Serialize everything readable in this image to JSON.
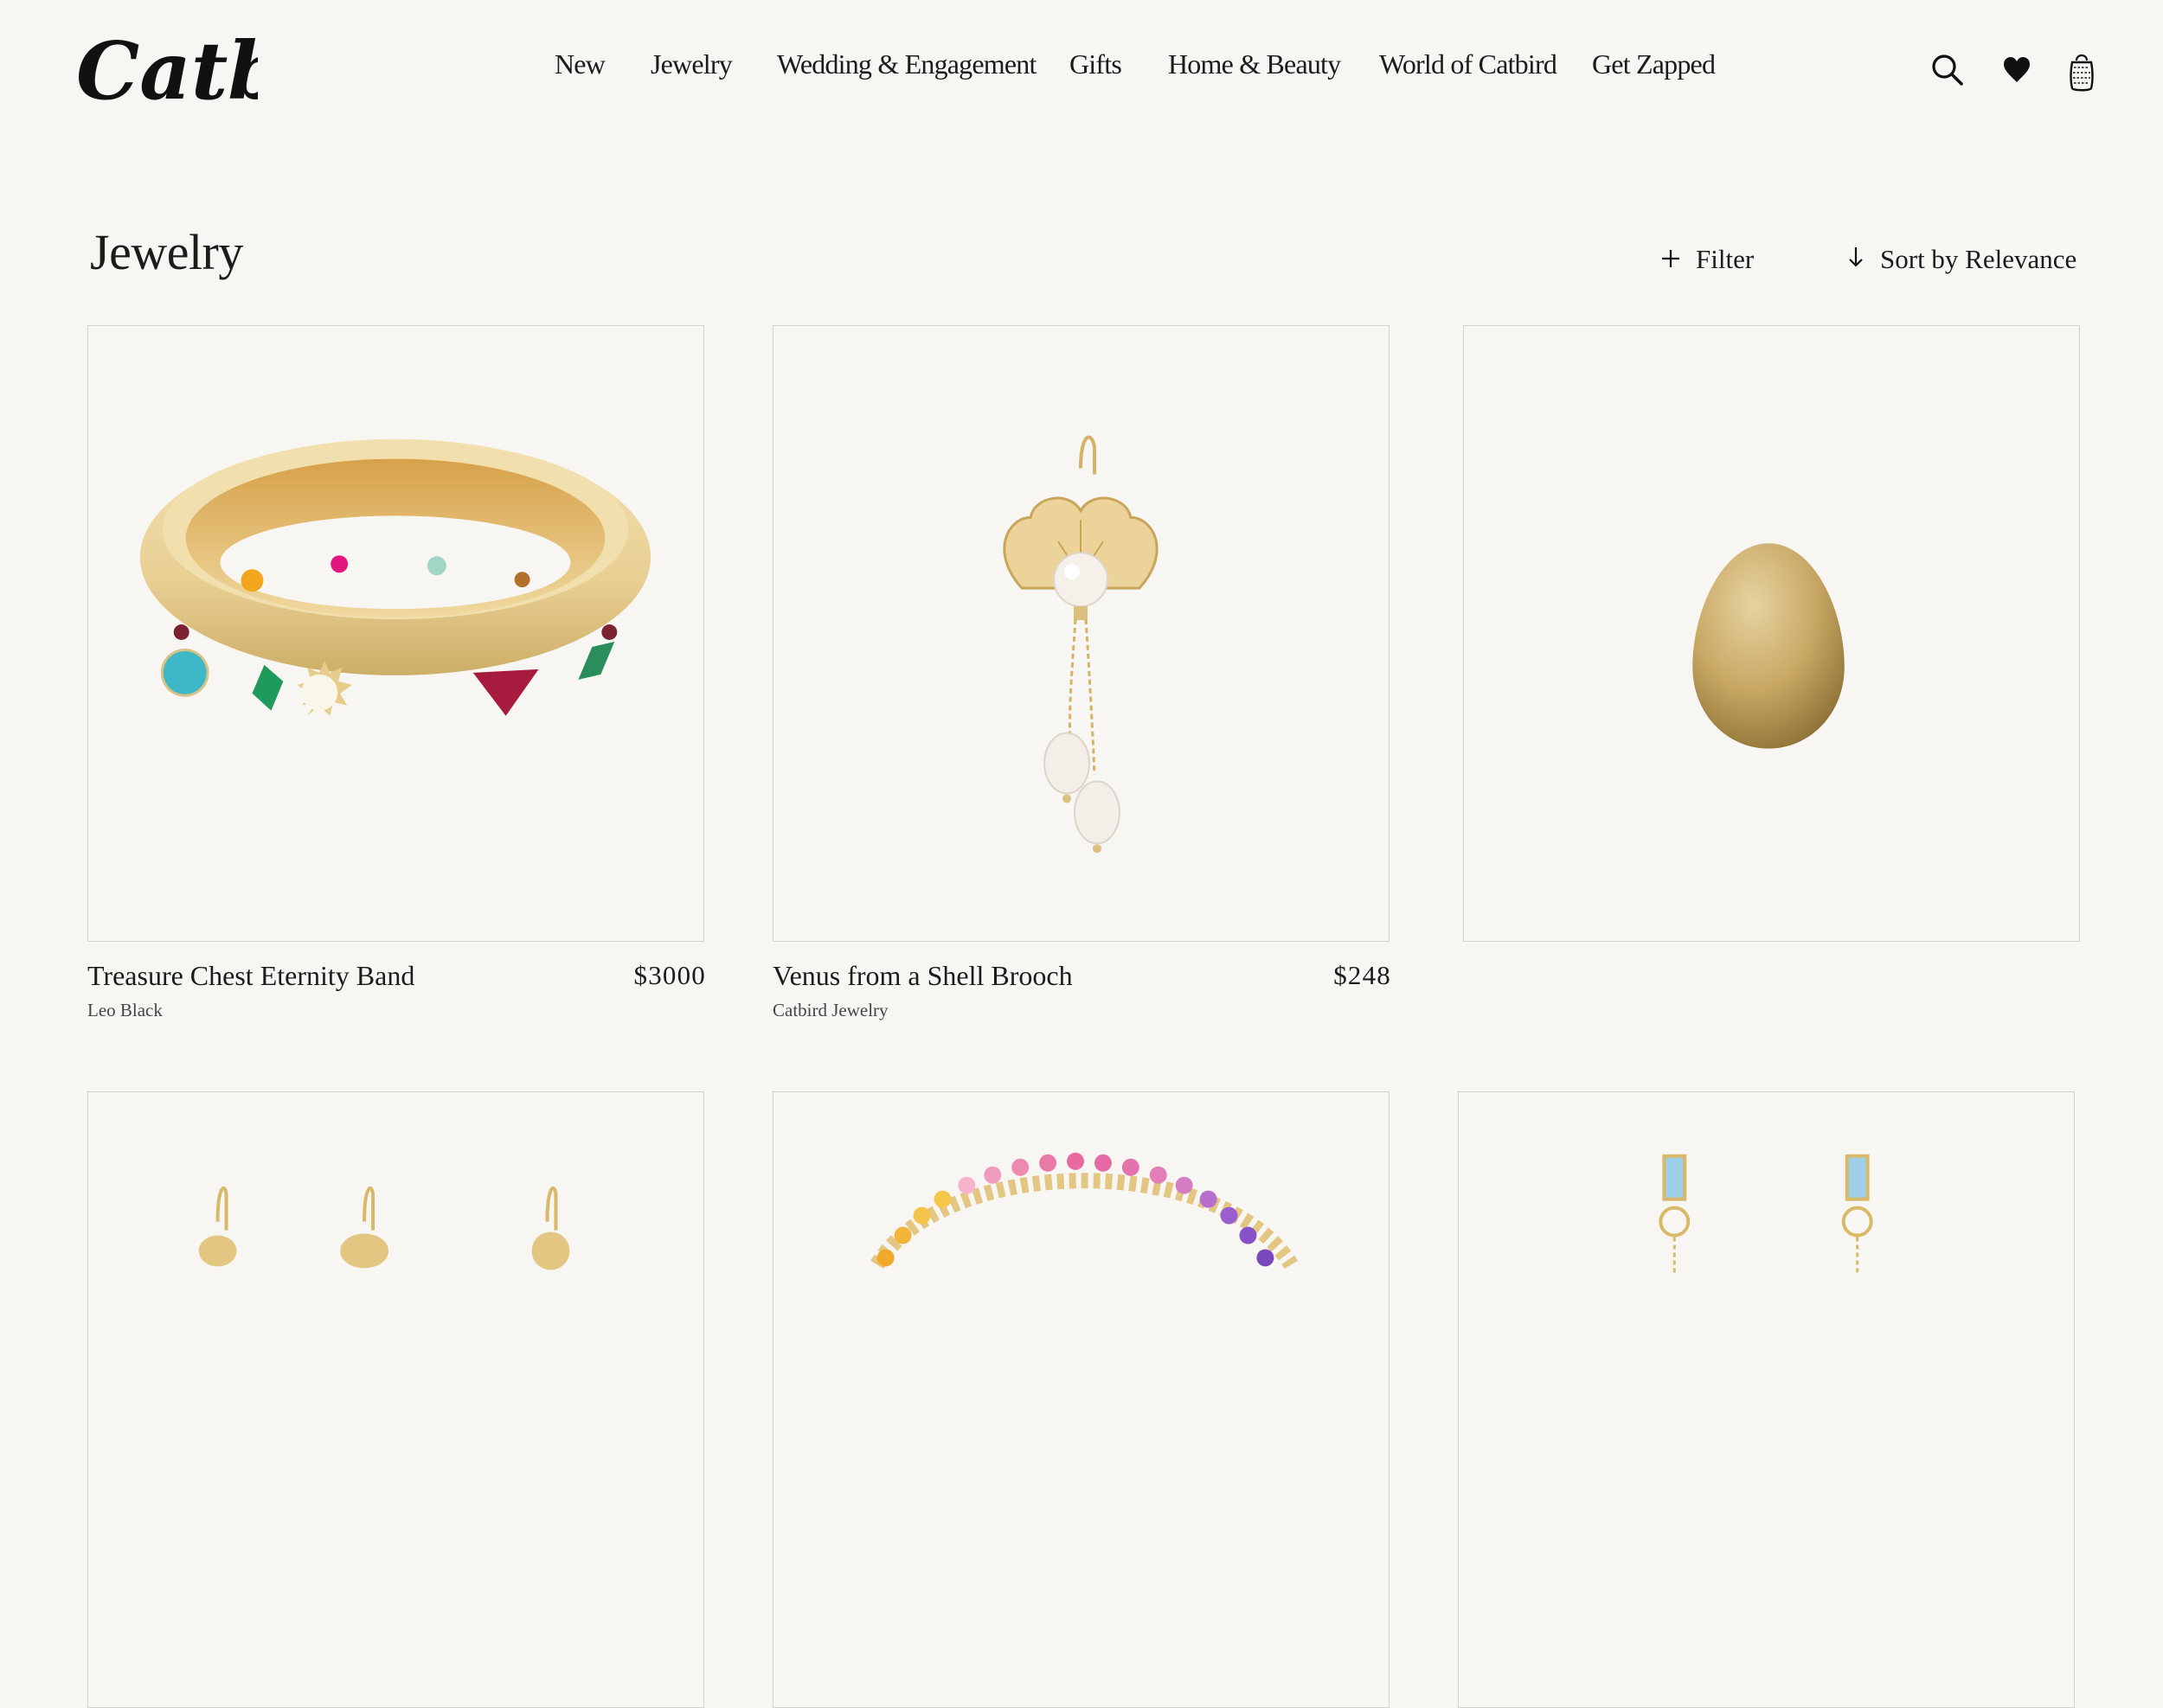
{
  "brand": {
    "logo_text": "Catbird"
  },
  "nav": {
    "items": [
      {
        "label": "New"
      },
      {
        "label": "Jewelry"
      },
      {
        "label": "Wedding & Engagement"
      },
      {
        "label": "Gifts"
      },
      {
        "label": "Home & Beauty"
      },
      {
        "label": "World of Catbird"
      },
      {
        "label": "Get Zapped"
      }
    ]
  },
  "header_icons": [
    "search-icon",
    "heart-icon",
    "bag-icon"
  ],
  "page": {
    "title": "Jewelry",
    "filter_label": "Filter",
    "sort_label": "Sort by Relevance"
  },
  "products": [
    {
      "title": "Treasure Chest Eternity Band",
      "price": "$3000",
      "brand": "Leo Black",
      "image": "gold ring with colorful gemstones"
    },
    {
      "title": "Venus from a Shell Brooch",
      "price": "$248",
      "brand": "Catbird Jewelry",
      "image": "gold shell earring with pearls"
    },
    {
      "title": "",
      "price": "",
      "brand": "",
      "image": "gold egg"
    },
    {
      "title": "",
      "price": "",
      "brand": "",
      "image": "gold charm earrings"
    },
    {
      "title": "",
      "price": "",
      "brand": "",
      "image": "rainbow gemstone necklace"
    },
    {
      "title": "",
      "price": "",
      "brand": "",
      "image": "blue baguette drop earrings"
    }
  ],
  "colors": {
    "background": "#f8f6f3",
    "text": "#1b1b1b",
    "gold": "#dcc07f",
    "card_border": "#d4d2cf"
  }
}
